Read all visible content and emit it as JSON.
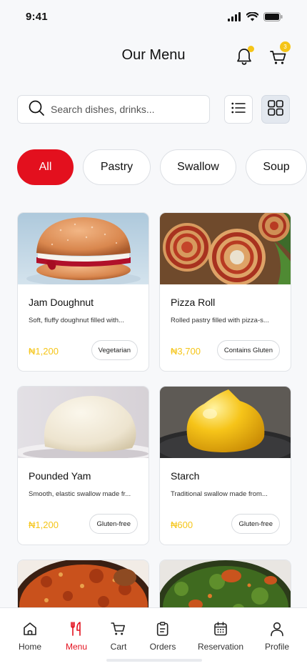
{
  "status_bar": {
    "time": "9:41",
    "icons": [
      "signal-icon",
      "wifi-icon",
      "battery-icon"
    ]
  },
  "header": {
    "title": "Our Menu",
    "notification_dot": true,
    "cart_count": "3"
  },
  "search": {
    "placeholder": "Search dishes, drinks...",
    "value": ""
  },
  "view_toggle": {
    "options": [
      "list",
      "grid"
    ],
    "selected": "grid"
  },
  "categories": [
    {
      "label": "All",
      "active": true
    },
    {
      "label": "Pastry",
      "active": false
    },
    {
      "label": "Swallow",
      "active": false
    },
    {
      "label": "Soup",
      "active": false
    }
  ],
  "menu_items": [
    {
      "name": "Jam Doughnut",
      "description": "Soft, fluffy doughnut filled with...",
      "price": "₦1,200",
      "tag": "Vegetarian"
    },
    {
      "name": "Pizza Roll",
      "description": "Rolled pastry filled with pizza-s...",
      "price": "₦3,700",
      "tag": "Contains Gluten"
    },
    {
      "name": "Pounded Yam",
      "description": "Smooth, elastic swallow made fr...",
      "price": "₦1,200",
      "tag": "Gluten-free"
    },
    {
      "name": "Starch",
      "description": "Traditional swallow made from...",
      "price": "₦600",
      "tag": "Gluten-free"
    }
  ],
  "bottom_nav": [
    {
      "label": "Home",
      "icon": "home-icon",
      "active": false
    },
    {
      "label": "Menu",
      "icon": "cutlery-icon",
      "active": true
    },
    {
      "label": "Cart",
      "icon": "cart-icon",
      "active": false
    },
    {
      "label": "Orders",
      "icon": "clipboard-icon",
      "active": false
    },
    {
      "label": "Reservation",
      "icon": "calendar-icon",
      "active": false
    },
    {
      "label": "Profile",
      "icon": "user-icon",
      "active": false
    }
  ],
  "colors": {
    "accent": "#e3101e",
    "price": "#f5c518",
    "badge": "#f5c518",
    "background": "#f7f8fa"
  }
}
